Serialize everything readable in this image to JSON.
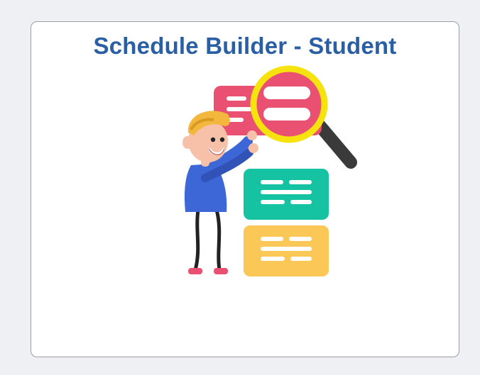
{
  "tile": {
    "title": "Schedule Builder - Student",
    "icon": "schedule-search-illustration"
  },
  "colors": {
    "page_background": "#eff0f3",
    "tile_background": "#ffffff",
    "tile_border": "#9a9da3",
    "title_text": "#2a5fa6",
    "card_red": "#ea5071",
    "card_green": "#15c3a3",
    "card_yellow": "#fbc757",
    "magnifier_ring": "#f6e20e",
    "person_shirt": "#3d66d6",
    "person_hair": "#f2b73c"
  }
}
